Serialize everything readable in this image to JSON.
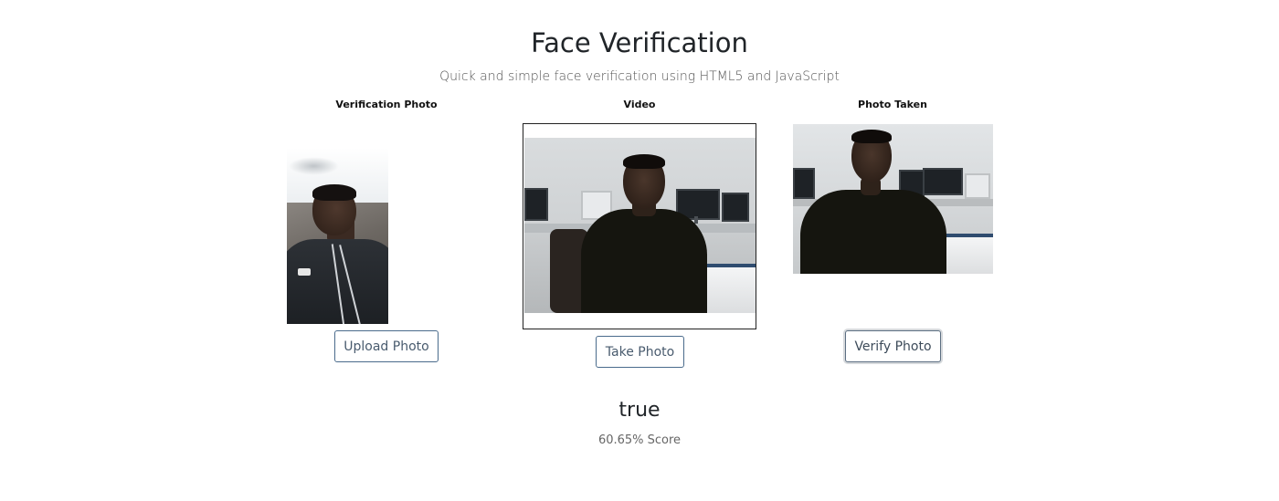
{
  "header": {
    "title": "Face Verification",
    "subtitle": "Quick and simple face verification using HTML5 and JavaScript"
  },
  "columns": {
    "verification": {
      "label": "Verification Photo",
      "button_label": "Upload Photo"
    },
    "video": {
      "label": "Video",
      "button_label": "Take Photo"
    },
    "taken": {
      "label": "Photo Taken",
      "button_label": "Verify Photo"
    }
  },
  "result": {
    "value": "true",
    "score_text": "60.65% Score"
  }
}
